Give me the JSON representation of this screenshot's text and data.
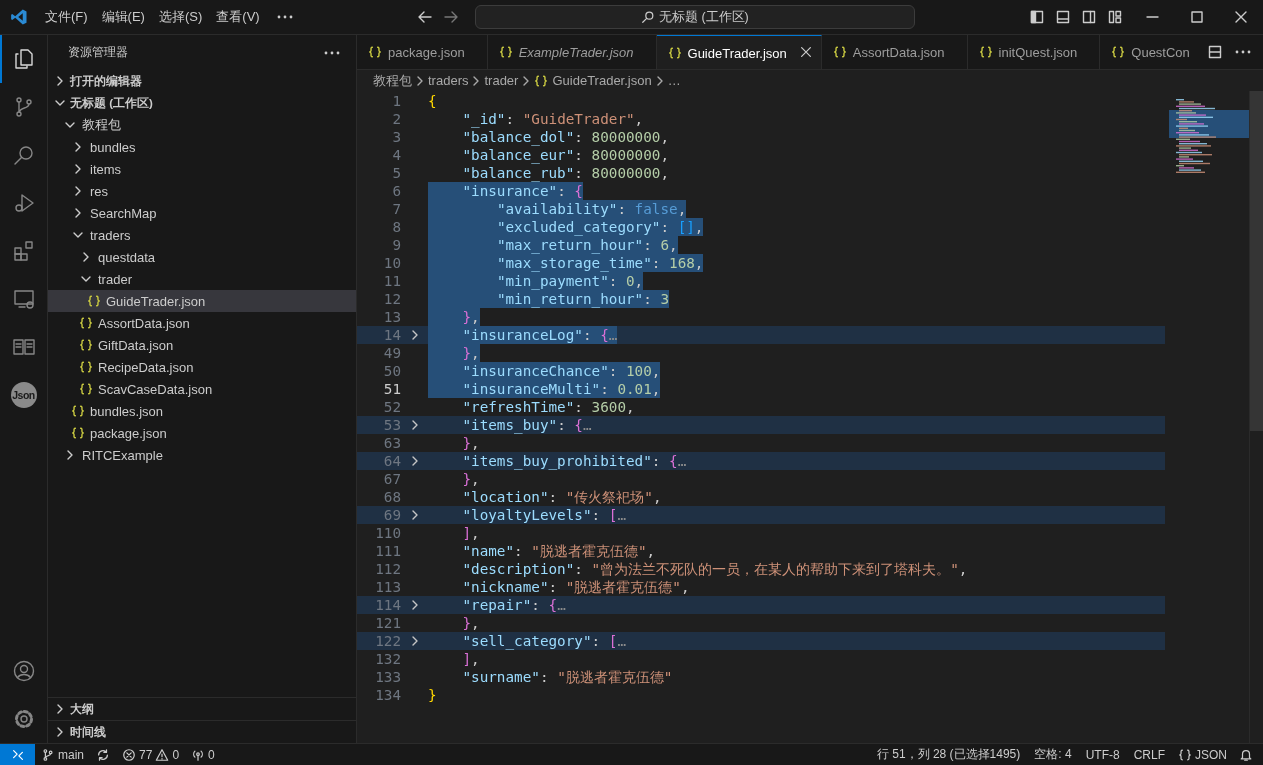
{
  "title_bar": {
    "menus": [
      "文件(F)",
      "编辑(E)",
      "选择(S)",
      "查看(V)"
    ],
    "command_center": "无标题 (工作区)"
  },
  "activity": [
    {
      "kind": "explorer",
      "selected": true
    },
    {
      "kind": "scm",
      "selected": false
    },
    {
      "kind": "search",
      "selected": false
    },
    {
      "kind": "debug",
      "selected": false
    },
    {
      "kind": "extensions",
      "selected": false
    },
    {
      "kind": "remote",
      "selected": false
    },
    {
      "kind": "book",
      "selected": false
    },
    {
      "kind": "json",
      "label": "Json",
      "selected": false
    }
  ],
  "activity_bottom": [
    {
      "kind": "account"
    },
    {
      "kind": "settings"
    }
  ],
  "sidebar": {
    "title": "资源管理器",
    "sections": [
      {
        "label": "打开的编辑器",
        "expanded": false
      },
      {
        "label": "无标题 (工作区)",
        "expanded": true,
        "tree": [
          {
            "label": "教程包",
            "kind": "folder",
            "expanded": true,
            "selected": false,
            "children": [
              {
                "label": "bundles",
                "kind": "folder",
                "expanded": false,
                "selected": false
              },
              {
                "label": "items",
                "kind": "folder",
                "expanded": false,
                "selected": false
              },
              {
                "label": "res",
                "kind": "folder",
                "expanded": false,
                "selected": false
              },
              {
                "label": "SearchMap",
                "kind": "folder",
                "expanded": false,
                "selected": false
              },
              {
                "label": "traders",
                "kind": "folder",
                "expanded": true,
                "selected": false,
                "children": [
                  {
                    "label": "questdata",
                    "kind": "folder",
                    "expanded": false,
                    "selected": false
                  },
                  {
                    "label": "trader",
                    "kind": "folder",
                    "expanded": true,
                    "selected": false,
                    "children": [
                      {
                        "label": "GuideTrader.json",
                        "kind": "file",
                        "selected": true
                      }
                    ]
                  },
                  {
                    "label": "AssortData.json",
                    "kind": "file",
                    "selected": false
                  },
                  {
                    "label": "GiftData.json",
                    "kind": "file",
                    "selected": false
                  },
                  {
                    "label": "RecipeData.json",
                    "kind": "file",
                    "selected": false
                  },
                  {
                    "label": "ScavCaseData.json",
                    "kind": "file",
                    "selected": false
                  }
                ]
              },
              {
                "label": "bundles.json",
                "kind": "file",
                "selected": false
              },
              {
                "label": "package.json",
                "kind": "file",
                "selected": false
              }
            ]
          },
          {
            "label": "RITCExample",
            "kind": "folder",
            "expanded": false,
            "selected": false
          }
        ]
      }
    ],
    "bottom_sections": [
      {
        "label": "大纲",
        "expanded": false
      },
      {
        "label": "时间线",
        "expanded": false
      }
    ]
  },
  "tabs": [
    {
      "label": "package.json",
      "preview": false,
      "selected": false
    },
    {
      "label": "ExampleTrader.json",
      "preview": true,
      "selected": false
    },
    {
      "label": "GuideTrader.json",
      "preview": false,
      "selected": true
    },
    {
      "label": "AssortData.json",
      "preview": false,
      "selected": false
    },
    {
      "label": "initQuest.json",
      "preview": false,
      "selected": false
    },
    {
      "label": "QuestCon",
      "preview": false,
      "selected": false
    }
  ],
  "breadcrumbs": [
    {
      "label": "教程包",
      "kind": "folder"
    },
    {
      "label": "traders",
      "kind": "folder"
    },
    {
      "label": "trader",
      "kind": "folder"
    },
    {
      "label": "GuideTrader.json",
      "kind": "file"
    },
    {
      "label": "…",
      "kind": "symbol"
    }
  ],
  "code": {
    "lines": [
      {
        "number": "1",
        "kind": "root",
        "tokens": [
          {
            "kind": "b1",
            "text": "{"
          }
        ],
        "selected": false,
        "folded": false,
        "current": false
      },
      {
        "number": "2",
        "kind": "member",
        "tokens": [
          {
            "kind": "k",
            "text": "\"_id\""
          },
          {
            "kind": "p",
            "text": ": "
          },
          {
            "kind": "s",
            "text": "\"GuideTrader\""
          },
          {
            "kind": "p",
            "text": ","
          }
        ],
        "selected": false,
        "folded": false,
        "current": false
      },
      {
        "number": "3",
        "kind": "member",
        "tokens": [
          {
            "kind": "k",
            "text": "\"balance_dol\""
          },
          {
            "kind": "p",
            "text": ": "
          },
          {
            "kind": "n",
            "text": "80000000"
          },
          {
            "kind": "p",
            "text": ","
          }
        ],
        "selected": false,
        "folded": false,
        "current": false
      },
      {
        "number": "4",
        "kind": "member",
        "tokens": [
          {
            "kind": "k",
            "text": "\"balance_eur\""
          },
          {
            "kind": "p",
            "text": ": "
          },
          {
            "kind": "n",
            "text": "80000000"
          },
          {
            "kind": "p",
            "text": ","
          }
        ],
        "selected": false,
        "folded": false,
        "current": false
      },
      {
        "number": "5",
        "kind": "member",
        "tokens": [
          {
            "kind": "k",
            "text": "\"balance_rub\""
          },
          {
            "kind": "p",
            "text": ": "
          },
          {
            "kind": "n",
            "text": "80000000"
          },
          {
            "kind": "p",
            "text": ","
          }
        ],
        "selected": false,
        "folded": false,
        "current": false
      },
      {
        "number": "6",
        "kind": "member",
        "tokens": [
          {
            "kind": "k",
            "text": "\"insurance\""
          },
          {
            "kind": "p",
            "text": ": "
          },
          {
            "kind": "b2",
            "text": "{"
          }
        ],
        "selected": true,
        "folded": false,
        "current": false
      },
      {
        "number": "7",
        "kind": "inner",
        "tokens": [
          {
            "kind": "k",
            "text": "\"availability\""
          },
          {
            "kind": "p",
            "text": ": "
          },
          {
            "kind": "c",
            "text": "false"
          },
          {
            "kind": "p",
            "text": ","
          }
        ],
        "selected": true,
        "folded": false,
        "current": false
      },
      {
        "number": "8",
        "kind": "inner",
        "tokens": [
          {
            "kind": "k",
            "text": "\"excluded_category\""
          },
          {
            "kind": "p",
            "text": ": "
          },
          {
            "kind": "b3",
            "text": "[]"
          },
          {
            "kind": "p",
            "text": ","
          }
        ],
        "selected": true,
        "folded": false,
        "current": false
      },
      {
        "number": "9",
        "kind": "inner",
        "tokens": [
          {
            "kind": "k",
            "text": "\"max_return_hour\""
          },
          {
            "kind": "p",
            "text": ": "
          },
          {
            "kind": "n",
            "text": "6"
          },
          {
            "kind": "p",
            "text": ","
          }
        ],
        "selected": true,
        "folded": false,
        "current": false
      },
      {
        "number": "10",
        "kind": "inner",
        "tokens": [
          {
            "kind": "k",
            "text": "\"max_storage_time\""
          },
          {
            "kind": "p",
            "text": ": "
          },
          {
            "kind": "n",
            "text": "168"
          },
          {
            "kind": "p",
            "text": ","
          }
        ],
        "selected": true,
        "folded": false,
        "current": false
      },
      {
        "number": "11",
        "kind": "inner",
        "tokens": [
          {
            "kind": "k",
            "text": "\"min_payment\""
          },
          {
            "kind": "p",
            "text": ": "
          },
          {
            "kind": "n",
            "text": "0"
          },
          {
            "kind": "p",
            "text": ","
          }
        ],
        "selected": true,
        "folded": false,
        "current": false
      },
      {
        "number": "12",
        "kind": "inner",
        "tokens": [
          {
            "kind": "k",
            "text": "\"min_return_hour\""
          },
          {
            "kind": "p",
            "text": ": "
          },
          {
            "kind": "n",
            "text": "3"
          }
        ],
        "selected": true,
        "folded": false,
        "current": false
      },
      {
        "number": "13",
        "kind": "member",
        "tokens": [
          {
            "kind": "b2",
            "text": "}"
          },
          {
            "kind": "p",
            "text": ","
          }
        ],
        "selected": true,
        "folded": false,
        "current": false
      },
      {
        "number": "14",
        "kind": "member",
        "tokens": [
          {
            "kind": "k",
            "text": "\"insuranceLog\""
          },
          {
            "kind": "p",
            "text": ": "
          },
          {
            "kind": "b2",
            "text": "{"
          },
          {
            "kind": "e",
            "text": "…"
          }
        ],
        "selected": true,
        "folded": true,
        "current": false
      },
      {
        "number": "49",
        "kind": "member",
        "tokens": [
          {
            "kind": "b2",
            "text": "}"
          },
          {
            "kind": "p",
            "text": ","
          }
        ],
        "selected": true,
        "folded": false,
        "current": false
      },
      {
        "number": "50",
        "kind": "member",
        "tokens": [
          {
            "kind": "k",
            "text": "\"insuranceChance\""
          },
          {
            "kind": "p",
            "text": ": "
          },
          {
            "kind": "n",
            "text": "100"
          },
          {
            "kind": "p",
            "text": ","
          }
        ],
        "selected": true,
        "folded": false,
        "current": false
      },
      {
        "number": "51",
        "kind": "member",
        "tokens": [
          {
            "kind": "k",
            "text": "\"insuranceMulti\""
          },
          {
            "kind": "p",
            "text": ": "
          },
          {
            "kind": "n",
            "text": "0.01"
          },
          {
            "kind": "p",
            "text": ","
          }
        ],
        "selected": true,
        "folded": false,
        "current": true
      },
      {
        "number": "52",
        "kind": "member",
        "tokens": [
          {
            "kind": "k",
            "text": "\"refreshTime\""
          },
          {
            "kind": "p",
            "text": ": "
          },
          {
            "kind": "n",
            "text": "3600"
          },
          {
            "kind": "p",
            "text": ","
          }
        ],
        "selected": false,
        "folded": false,
        "current": false
      },
      {
        "number": "53",
        "kind": "member",
        "tokens": [
          {
            "kind": "k",
            "text": "\"items_buy\""
          },
          {
            "kind": "p",
            "text": ": "
          },
          {
            "kind": "b2",
            "text": "{"
          },
          {
            "kind": "e",
            "text": "…"
          }
        ],
        "selected": false,
        "folded": true,
        "current": false
      },
      {
        "number": "63",
        "kind": "member",
        "tokens": [
          {
            "kind": "b2",
            "text": "}"
          },
          {
            "kind": "p",
            "text": ","
          }
        ],
        "selected": false,
        "folded": false,
        "current": false
      },
      {
        "number": "64",
        "kind": "member",
        "tokens": [
          {
            "kind": "k",
            "text": "\"items_buy_prohibited\""
          },
          {
            "kind": "p",
            "text": ": "
          },
          {
            "kind": "b2",
            "text": "{"
          },
          {
            "kind": "e",
            "text": "…"
          }
        ],
        "selected": false,
        "folded": true,
        "current": false
      },
      {
        "number": "67",
        "kind": "member",
        "tokens": [
          {
            "kind": "b2",
            "text": "}"
          },
          {
            "kind": "p",
            "text": ","
          }
        ],
        "selected": false,
        "folded": false,
        "current": false
      },
      {
        "number": "68",
        "kind": "member",
        "tokens": [
          {
            "kind": "k",
            "text": "\"location\""
          },
          {
            "kind": "p",
            "text": ": "
          },
          {
            "kind": "s",
            "text": "\"传火祭祀场\""
          },
          {
            "kind": "p",
            "text": ","
          }
        ],
        "selected": false,
        "folded": false,
        "current": false
      },
      {
        "number": "69",
        "kind": "member",
        "tokens": [
          {
            "kind": "k",
            "text": "\"loyaltyLevels\""
          },
          {
            "kind": "p",
            "text": ": "
          },
          {
            "kind": "b2",
            "text": "["
          },
          {
            "kind": "e",
            "text": "…"
          }
        ],
        "selected": false,
        "folded": true,
        "current": false
      },
      {
        "number": "110",
        "kind": "member",
        "tokens": [
          {
            "kind": "b2",
            "text": "]"
          },
          {
            "kind": "p",
            "text": ","
          }
        ],
        "selected": false,
        "folded": false,
        "current": false
      },
      {
        "number": "111",
        "kind": "member",
        "tokens": [
          {
            "kind": "k",
            "text": "\"name\""
          },
          {
            "kind": "p",
            "text": ": "
          },
          {
            "kind": "s",
            "text": "\"脱逃者霍克伍德\""
          },
          {
            "kind": "p",
            "text": ","
          }
        ],
        "selected": false,
        "folded": false,
        "current": false
      },
      {
        "number": "112",
        "kind": "member",
        "tokens": [
          {
            "kind": "k",
            "text": "\"description\""
          },
          {
            "kind": "p",
            "text": ": "
          },
          {
            "kind": "s",
            "text": "\"曾为法兰不死队的一员，在某人的帮助下来到了塔科夫。\""
          },
          {
            "kind": "p",
            "text": ","
          }
        ],
        "selected": false,
        "folded": false,
        "current": false
      },
      {
        "number": "113",
        "kind": "member",
        "tokens": [
          {
            "kind": "k",
            "text": "\"nickname\""
          },
          {
            "kind": "p",
            "text": ": "
          },
          {
            "kind": "s",
            "text": "\"脱逃者霍克伍德\""
          },
          {
            "kind": "p",
            "text": ","
          }
        ],
        "selected": false,
        "folded": false,
        "current": false
      },
      {
        "number": "114",
        "kind": "member",
        "tokens": [
          {
            "kind": "k",
            "text": "\"repair\""
          },
          {
            "kind": "p",
            "text": ": "
          },
          {
            "kind": "b2",
            "text": "{"
          },
          {
            "kind": "e",
            "text": "…"
          }
        ],
        "selected": false,
        "folded": true,
        "current": false
      },
      {
        "number": "121",
        "kind": "member",
        "tokens": [
          {
            "kind": "b2",
            "text": "}"
          },
          {
            "kind": "p",
            "text": ","
          }
        ],
        "selected": false,
        "folded": false,
        "current": false
      },
      {
        "number": "122",
        "kind": "member",
        "tokens": [
          {
            "kind": "k",
            "text": "\"sell_category\""
          },
          {
            "kind": "p",
            "text": ": "
          },
          {
            "kind": "b2",
            "text": "["
          },
          {
            "kind": "e",
            "text": "…"
          }
        ],
        "selected": false,
        "folded": true,
        "current": false
      },
      {
        "number": "132",
        "kind": "member",
        "tokens": [
          {
            "kind": "b2",
            "text": "]"
          },
          {
            "kind": "p",
            "text": ","
          }
        ],
        "selected": false,
        "folded": false,
        "current": false
      },
      {
        "number": "133",
        "kind": "member",
        "tokens": [
          {
            "kind": "k",
            "text": "\"surname\""
          },
          {
            "kind": "p",
            "text": ": "
          },
          {
            "kind": "s",
            "text": "\"脱逃者霍克伍德\""
          }
        ],
        "selected": false,
        "folded": false,
        "current": false
      },
      {
        "number": "134",
        "kind": "root",
        "tokens": [
          {
            "kind": "b1",
            "text": "}"
          }
        ],
        "selected": false,
        "folded": false,
        "current": false
      }
    ]
  },
  "status_bar": {
    "branch": "main",
    "errors": "77",
    "warnings": "0",
    "ports": "0",
    "right": [
      "行 51，列 28 (已选择1495)",
      "空格: 4",
      "UTF-8",
      "CRLF"
    ],
    "language": "JSON"
  }
}
